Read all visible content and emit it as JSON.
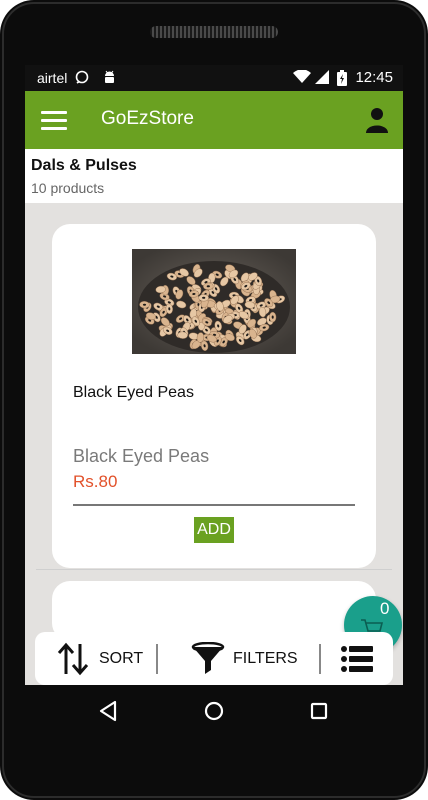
{
  "status_bar": {
    "carrier": "airtel",
    "time": "12:45",
    "icons": [
      "whatsapp-icon",
      "android-icon",
      "wifi-icon",
      "signal-icon",
      "battery-charging-icon"
    ]
  },
  "app_bar": {
    "title": "GoEzStore",
    "menu_icon": "hamburger-menu-icon",
    "profile_icon": "user-profile-icon"
  },
  "category": {
    "title": "Dals & Pulses",
    "count": "10 products"
  },
  "products": [
    {
      "image": "black-eyed-peas-photo",
      "name": "Black Eyed Peas",
      "variant_name": "Black Eyed Peas",
      "price": "Rs.80",
      "add_label": "ADD"
    }
  ],
  "cart": {
    "count": "0",
    "icon": "shopping-cart-icon",
    "color": "#1a9f8b"
  },
  "action_bar": {
    "sort_label": "SORT",
    "filters_label": "FILTERS",
    "sort_icon": "sort-arrows-icon",
    "filter_icon": "funnel-icon",
    "list_icon": "list-view-icon"
  },
  "nav": {
    "back_icon": "back-triangle-icon",
    "home_icon": "home-circle-icon",
    "recents_icon": "recents-square-icon"
  },
  "colors": {
    "accent": "#6aa121",
    "price": "#e2512a",
    "background": "#e3e1df"
  }
}
